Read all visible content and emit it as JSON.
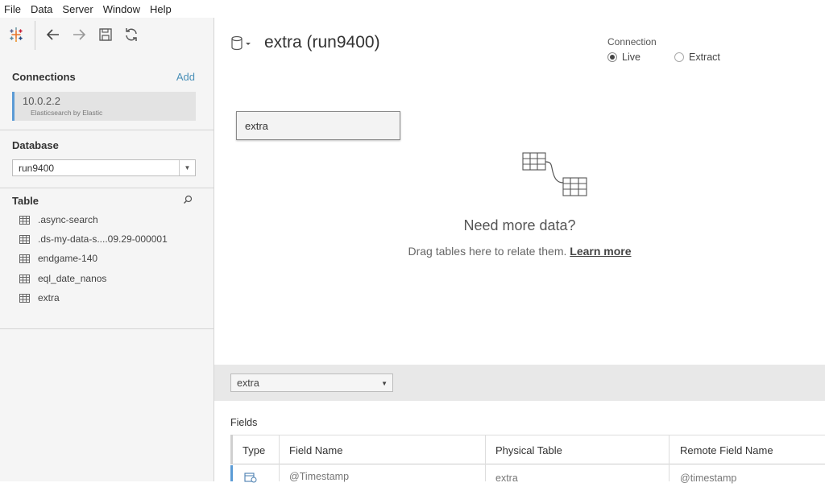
{
  "menu": [
    "File",
    "Data",
    "Server",
    "Window",
    "Help"
  ],
  "sidebar": {
    "connections_title": "Connections",
    "add_label": "Add",
    "connection": {
      "name": "10.0.2.2",
      "type": "Elasticsearch by Elastic"
    },
    "database_title": "Database",
    "database_value": "run9400",
    "table_title": "Table",
    "tables": [
      ".async-search",
      ".ds-my-data-s....09.29-000001",
      "endgame-140",
      "eql_date_nanos",
      "extra"
    ]
  },
  "main": {
    "datasource_title": "extra (run9400)",
    "connection_label": "Connection",
    "connection_options": {
      "live": "Live",
      "extract": "Extract"
    },
    "selected_connection": "live",
    "canvas_table": "extra",
    "empty_title": "Need more data?",
    "empty_hint": "Drag tables here to relate them.",
    "learn_more": "Learn more",
    "table_select_value": "extra",
    "fields_title": "Fields",
    "columns": [
      "Type",
      "Field Name",
      "Physical Table",
      "Remote Field Name"
    ],
    "rows": [
      {
        "type_icon": "calendar-clock-icon",
        "field_name": "@Timestamp",
        "physical_table": "extra",
        "remote_field_name": "@timestamp"
      }
    ]
  },
  "colors": {
    "accent": "#5b9bd5",
    "link": "#4a90b8"
  }
}
